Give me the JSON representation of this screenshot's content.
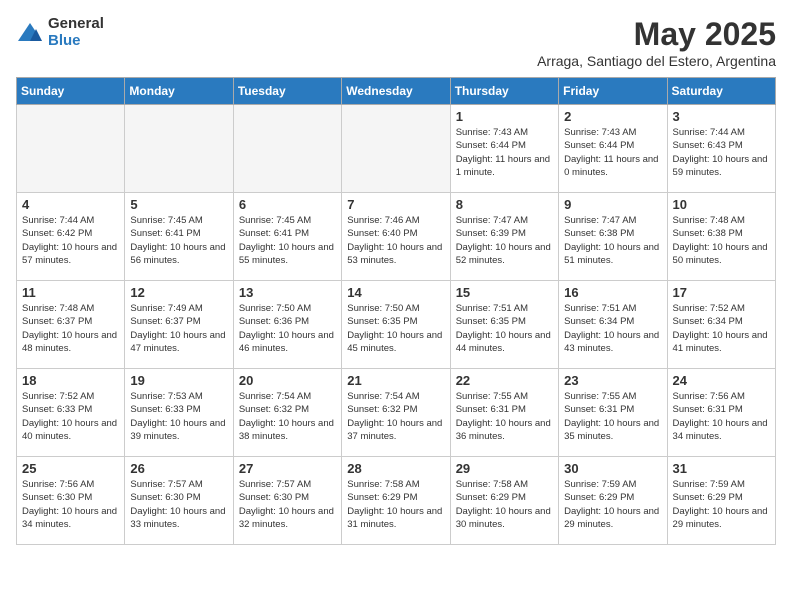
{
  "logo": {
    "general": "General",
    "blue": "Blue"
  },
  "title": "May 2025",
  "subtitle": "Arraga, Santiago del Estero, Argentina",
  "days_of_week": [
    "Sunday",
    "Monday",
    "Tuesday",
    "Wednesday",
    "Thursday",
    "Friday",
    "Saturday"
  ],
  "weeks": [
    [
      {
        "day": "",
        "info": "",
        "empty": true
      },
      {
        "day": "",
        "info": "",
        "empty": true
      },
      {
        "day": "",
        "info": "",
        "empty": true
      },
      {
        "day": "",
        "info": "",
        "empty": true
      },
      {
        "day": "1",
        "info": "Sunrise: 7:43 AM\nSunset: 6:44 PM\nDaylight: 11 hours and 1 minute."
      },
      {
        "day": "2",
        "info": "Sunrise: 7:43 AM\nSunset: 6:44 PM\nDaylight: 11 hours and 0 minutes."
      },
      {
        "day": "3",
        "info": "Sunrise: 7:44 AM\nSunset: 6:43 PM\nDaylight: 10 hours and 59 minutes."
      }
    ],
    [
      {
        "day": "4",
        "info": "Sunrise: 7:44 AM\nSunset: 6:42 PM\nDaylight: 10 hours and 57 minutes."
      },
      {
        "day": "5",
        "info": "Sunrise: 7:45 AM\nSunset: 6:41 PM\nDaylight: 10 hours and 56 minutes."
      },
      {
        "day": "6",
        "info": "Sunrise: 7:45 AM\nSunset: 6:41 PM\nDaylight: 10 hours and 55 minutes."
      },
      {
        "day": "7",
        "info": "Sunrise: 7:46 AM\nSunset: 6:40 PM\nDaylight: 10 hours and 53 minutes."
      },
      {
        "day": "8",
        "info": "Sunrise: 7:47 AM\nSunset: 6:39 PM\nDaylight: 10 hours and 52 minutes."
      },
      {
        "day": "9",
        "info": "Sunrise: 7:47 AM\nSunset: 6:38 PM\nDaylight: 10 hours and 51 minutes."
      },
      {
        "day": "10",
        "info": "Sunrise: 7:48 AM\nSunset: 6:38 PM\nDaylight: 10 hours and 50 minutes."
      }
    ],
    [
      {
        "day": "11",
        "info": "Sunrise: 7:48 AM\nSunset: 6:37 PM\nDaylight: 10 hours and 48 minutes."
      },
      {
        "day": "12",
        "info": "Sunrise: 7:49 AM\nSunset: 6:37 PM\nDaylight: 10 hours and 47 minutes."
      },
      {
        "day": "13",
        "info": "Sunrise: 7:50 AM\nSunset: 6:36 PM\nDaylight: 10 hours and 46 minutes."
      },
      {
        "day": "14",
        "info": "Sunrise: 7:50 AM\nSunset: 6:35 PM\nDaylight: 10 hours and 45 minutes."
      },
      {
        "day": "15",
        "info": "Sunrise: 7:51 AM\nSunset: 6:35 PM\nDaylight: 10 hours and 44 minutes."
      },
      {
        "day": "16",
        "info": "Sunrise: 7:51 AM\nSunset: 6:34 PM\nDaylight: 10 hours and 43 minutes."
      },
      {
        "day": "17",
        "info": "Sunrise: 7:52 AM\nSunset: 6:34 PM\nDaylight: 10 hours and 41 minutes."
      }
    ],
    [
      {
        "day": "18",
        "info": "Sunrise: 7:52 AM\nSunset: 6:33 PM\nDaylight: 10 hours and 40 minutes."
      },
      {
        "day": "19",
        "info": "Sunrise: 7:53 AM\nSunset: 6:33 PM\nDaylight: 10 hours and 39 minutes."
      },
      {
        "day": "20",
        "info": "Sunrise: 7:54 AM\nSunset: 6:32 PM\nDaylight: 10 hours and 38 minutes."
      },
      {
        "day": "21",
        "info": "Sunrise: 7:54 AM\nSunset: 6:32 PM\nDaylight: 10 hours and 37 minutes."
      },
      {
        "day": "22",
        "info": "Sunrise: 7:55 AM\nSunset: 6:31 PM\nDaylight: 10 hours and 36 minutes."
      },
      {
        "day": "23",
        "info": "Sunrise: 7:55 AM\nSunset: 6:31 PM\nDaylight: 10 hours and 35 minutes."
      },
      {
        "day": "24",
        "info": "Sunrise: 7:56 AM\nSunset: 6:31 PM\nDaylight: 10 hours and 34 minutes."
      }
    ],
    [
      {
        "day": "25",
        "info": "Sunrise: 7:56 AM\nSunset: 6:30 PM\nDaylight: 10 hours and 34 minutes."
      },
      {
        "day": "26",
        "info": "Sunrise: 7:57 AM\nSunset: 6:30 PM\nDaylight: 10 hours and 33 minutes."
      },
      {
        "day": "27",
        "info": "Sunrise: 7:57 AM\nSunset: 6:30 PM\nDaylight: 10 hours and 32 minutes."
      },
      {
        "day": "28",
        "info": "Sunrise: 7:58 AM\nSunset: 6:29 PM\nDaylight: 10 hours and 31 minutes."
      },
      {
        "day": "29",
        "info": "Sunrise: 7:58 AM\nSunset: 6:29 PM\nDaylight: 10 hours and 30 minutes."
      },
      {
        "day": "30",
        "info": "Sunrise: 7:59 AM\nSunset: 6:29 PM\nDaylight: 10 hours and 29 minutes."
      },
      {
        "day": "31",
        "info": "Sunrise: 7:59 AM\nSunset: 6:29 PM\nDaylight: 10 hours and 29 minutes."
      }
    ]
  ]
}
